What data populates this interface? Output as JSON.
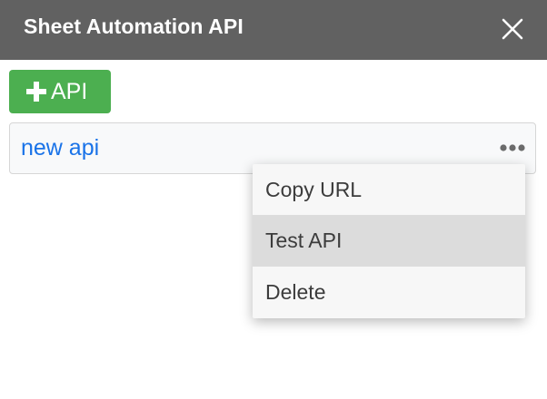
{
  "header": {
    "title": "Sheet Automation API",
    "close_icon": "close-icon"
  },
  "toolbar": {
    "add_label": "API",
    "add_icon": "plus-icon",
    "accent": "#4caf50"
  },
  "api_list": [
    {
      "name": "new api",
      "more_icon": "more-horizontal-icon"
    }
  ],
  "context_menu": {
    "items": [
      {
        "label": "Copy URL",
        "highlighted": false
      },
      {
        "label": "Test API",
        "highlighted": true
      },
      {
        "label": "Delete",
        "highlighted": false
      }
    ]
  },
  "colors": {
    "titlebar": "#616161",
    "link": "#1a73e8",
    "menu_highlight": "#dcdcdc"
  }
}
